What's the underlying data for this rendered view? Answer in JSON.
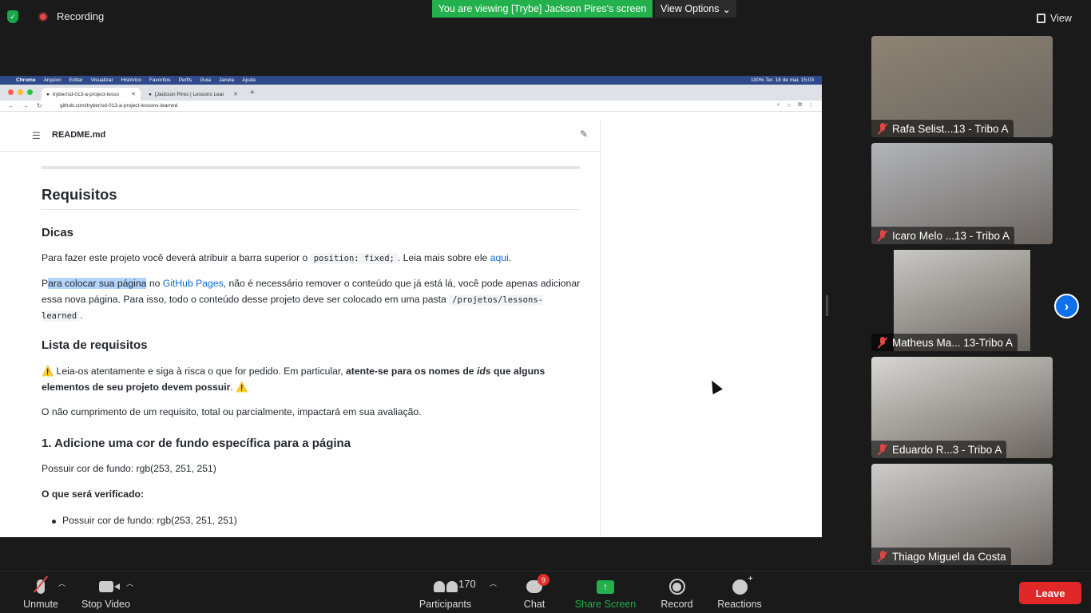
{
  "top": {
    "recording_label": "Recording",
    "viewing_banner": "You are viewing [Trybe] Jackson Pires's screen",
    "view_options": "View Options",
    "view_label": "View"
  },
  "mac": {
    "menu": [
      "Chrome",
      "Arquivo",
      "Editar",
      "Visualizar",
      "Histórico",
      "Favoritos",
      "Perfis",
      "Guia",
      "Janela",
      "Ajuda"
    ],
    "status": "100%  Ter. 18 de mai.  15:03"
  },
  "browser": {
    "tab1": "tryber/sd-013-a-project-lesso",
    "tab2": "[Jackson Pires | Lessons Lear",
    "url": "github.com/tryber/sd-013-a-project-lessons-learned"
  },
  "readme": {
    "filename": "README.md",
    "h1": "Requisitos",
    "dicas": "Dicas",
    "p1_a": "Para fazer este projeto você deverá atribuir a barra superior o",
    "p1_code": "position: fixed;",
    "p1_b": ". Leia mais sobre ele",
    "p1_link": "aqui",
    "p1_c": ".",
    "p2_a": "P",
    "p2_hl": "ara colocar sua página",
    "p2_b": " no ",
    "p2_link": "GitHub Pages",
    "p2_c": ", não é necessário remover o conteúdo que já está lá, você pode apenas adicionar essa nova página. Para isso, todo o conteúdo desse projeto deve ser colocado em uma pasta",
    "p2_code": "/projetos/lessons-learned",
    "p2_d": ".",
    "lista": "Lista de requisitos",
    "p3_a": "⚠️ Leia-os atentamente e siga à risca o que for pedido. Em particular,",
    "p3_b": "atente-se para os nomes de",
    "p3_ids": "ids",
    "p3_c": "que alguns elementos de seu projeto devem possuir",
    "p3_d": ". ⚠️",
    "p4": "O não cumprimento de um requisito, total ou parcialmente, impactará em sua avaliação.",
    "h_req1": "1. Adicione uma cor de fundo específica para a página",
    "p5": "Possuir cor de fundo: rgb(253, 251, 251)",
    "p6": "O que será verificado:",
    "li1": "Possuir cor de fundo: rgb(253, 251, 251)"
  },
  "participants": [
    {
      "name": "Rafa Selist...13 - Tribo A",
      "bg": "#8d8474"
    },
    {
      "name": "Icaro Melo ...13 - Tribo A",
      "bg": "#b3b5b9"
    },
    {
      "name": "Matheus Ma... 13-Tribo A",
      "bg": "#c9c8c4"
    },
    {
      "name": "Eduardo  R...3 - Tribo A",
      "bg": "#d7d6d2"
    },
    {
      "name": "Thiago Miguel da Costa",
      "bg": "#ccccca"
    }
  ],
  "toolbar": {
    "unmute": "Unmute",
    "stop_video": "Stop Video",
    "participants": "Participants",
    "participants_count": "170",
    "chat": "Chat",
    "chat_badge": "9",
    "share": "Share Screen",
    "record": "Record",
    "reactions": "Reactions",
    "leave": "Leave"
  },
  "colors": {
    "green": "#22b14c",
    "blue": "#0e71eb",
    "red": "#e02828",
    "link": "#0969da"
  }
}
